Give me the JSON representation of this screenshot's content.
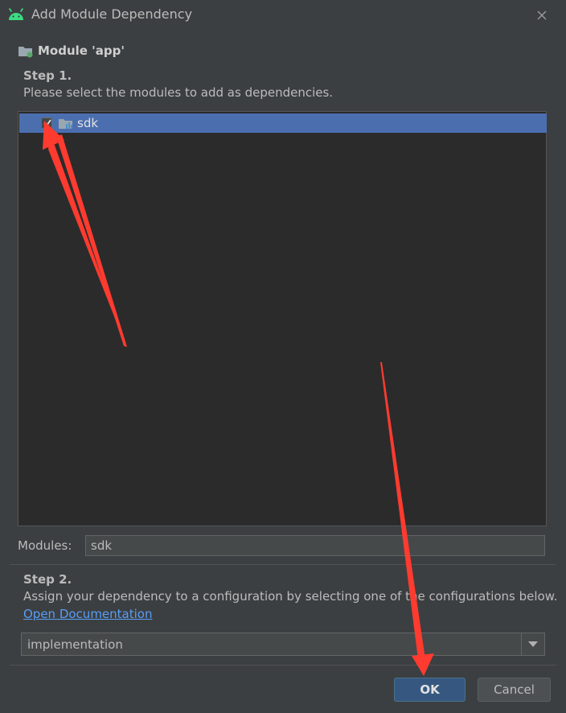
{
  "window": {
    "title": "Add Module Dependency",
    "icon": "android-icon"
  },
  "module": {
    "title": "Module 'app'",
    "icon": "folder-icon"
  },
  "step1": {
    "title": "Step 1.",
    "description": "Please select the modules to add as dependencies."
  },
  "modules_list": [
    {
      "label": "sdk",
      "checked": true,
      "selected": true,
      "icon": "module-folder-icon"
    }
  ],
  "modules_field": {
    "label": "Modules:",
    "value": "sdk"
  },
  "step2": {
    "title": "Step 2.",
    "description": "Assign your dependency to a configuration by selecting one of the configurations below.",
    "link": "Open Documentation"
  },
  "configuration": {
    "selected": "implementation"
  },
  "buttons": {
    "ok": "OK",
    "cancel": "Cancel"
  },
  "colors": {
    "background": "#3c3f41",
    "list_background": "#2b2b2b",
    "selection": "#4b6eaf",
    "link": "#589df6",
    "annotation_arrow": "#ff3b30",
    "android_green": "#3ddc84"
  }
}
